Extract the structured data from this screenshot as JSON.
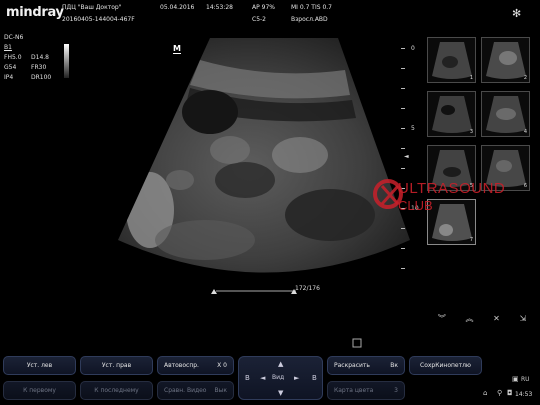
{
  "header": {
    "logo": "mindray",
    "clinic": "ПДЦ \"Ваш Доктор\"",
    "date": "05.04.2016",
    "time": "14:53:28",
    "ap": "AP  97%",
    "mi_tis": "MI 0.7  TIS 0.7",
    "exam_id": "20160405-144004-467F",
    "probe": "C5-2",
    "preset": "Взросл.ABD"
  },
  "params": {
    "mode": "DC-N6",
    "b1": "B1",
    "rows": [
      {
        "k": "FH5.0",
        "v": "D14.8"
      },
      {
        "k": "G54",
        "v": "FR30"
      },
      {
        "k": "IP4",
        "v": "DR100"
      }
    ]
  },
  "image": {
    "marker": "M",
    "frame_counter": "172/176"
  },
  "depth_scale": {
    "labels": [
      "0",
      "5",
      "10"
    ]
  },
  "thumbnails": [
    "1",
    "2",
    "3",
    "4",
    "5",
    "6",
    "7"
  ],
  "watermark": {
    "line1": "ULTRASOUND",
    "line2": "CLUB"
  },
  "toolbar_icons": [
    "chevrons-down-icon",
    "chevrons-up-icon",
    "x-mark-icon",
    "export-icon"
  ],
  "buttons": {
    "row1": {
      "set_left": "Уст. лев",
      "set_right": "Уст. прав",
      "autoplay": "Автовоспр.",
      "autoplay_val": "X 0",
      "colorize": "Раскрасить",
      "colorize_val": "Вк",
      "save_cine": "СохрКинопетлю"
    },
    "row2": {
      "to_first": "К первому",
      "to_last": "К последнему",
      "compare": "Сравн. Видео",
      "compare_val": "Вык",
      "color_map": "Карта цвета",
      "color_map_val": "3"
    },
    "view": {
      "up": "▲",
      "down": "▼",
      "left": "◄",
      "right": "►",
      "label": "Вид",
      "left_b": "B",
      "right_b": "B"
    }
  },
  "system": {
    "lang": "RU",
    "clock": "14:53"
  },
  "colors": {
    "accent_red": "#c8202a",
    "button_border": "#2f3b5a"
  }
}
